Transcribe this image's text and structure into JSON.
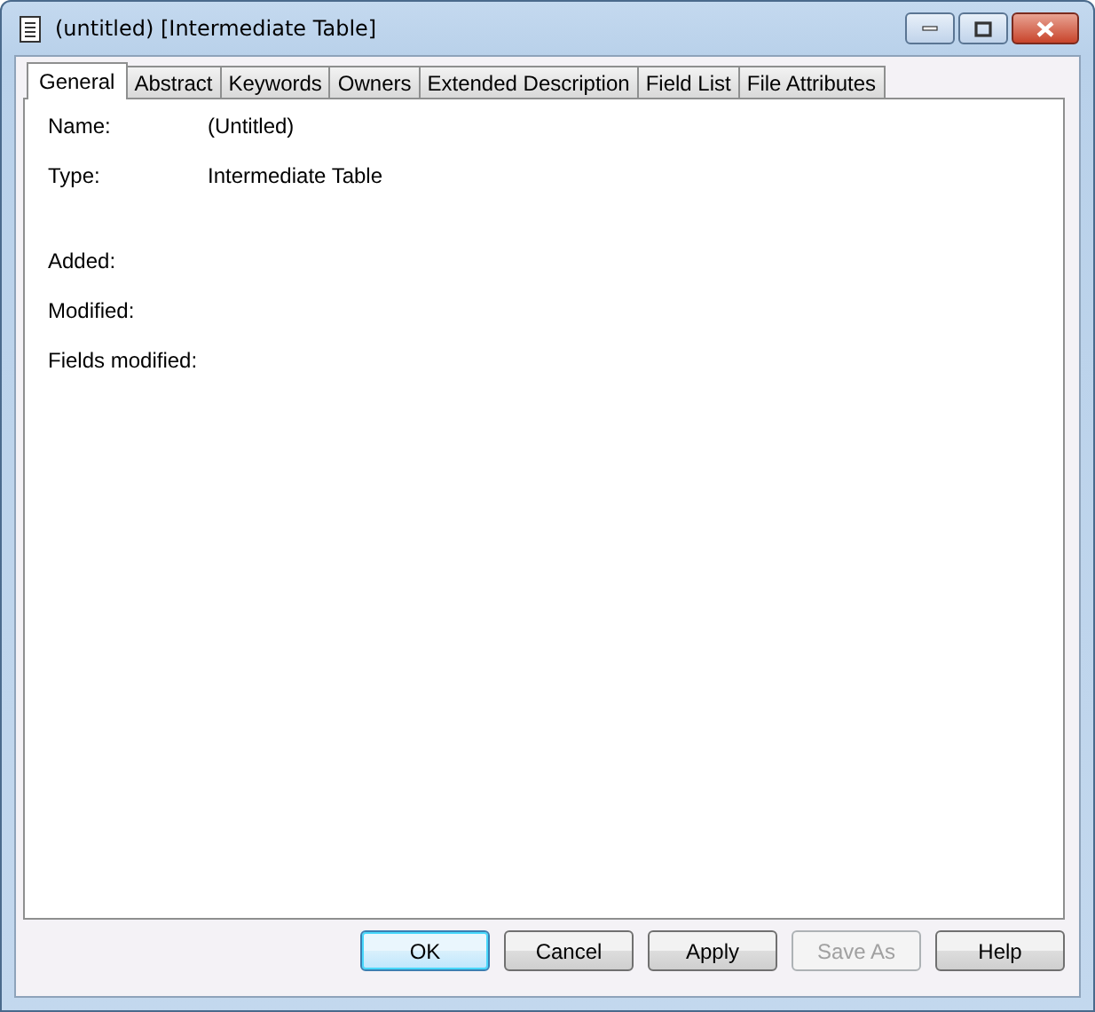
{
  "window": {
    "title": "(untitled) [Intermediate Table]"
  },
  "tabs": [
    {
      "label": "General",
      "selected": true
    },
    {
      "label": "Abstract",
      "selected": false
    },
    {
      "label": "Keywords",
      "selected": false
    },
    {
      "label": "Owners",
      "selected": false
    },
    {
      "label": "Extended Description",
      "selected": false
    },
    {
      "label": "Field List",
      "selected": false
    },
    {
      "label": "File Attributes",
      "selected": false
    }
  ],
  "field_groups": [
    {
      "fields": [
        {
          "label": "Name:",
          "value": "(Untitled)"
        },
        {
          "label": "Type:",
          "value": "Intermediate Table"
        }
      ]
    },
    {
      "fields": [
        {
          "label": "Added:"
        },
        {
          "label": "Modified:"
        },
        {
          "label": "Fields modified:"
        }
      ]
    }
  ],
  "buttons": [
    {
      "label": "OK",
      "default": true,
      "disabled": false
    },
    {
      "label": "Cancel",
      "default": false,
      "disabled": false
    },
    {
      "label": "Apply",
      "default": false,
      "disabled": false
    },
    {
      "label": "Save As",
      "default": false,
      "disabled": true
    },
    {
      "label": "Help",
      "default": false,
      "disabled": false
    }
  ]
}
